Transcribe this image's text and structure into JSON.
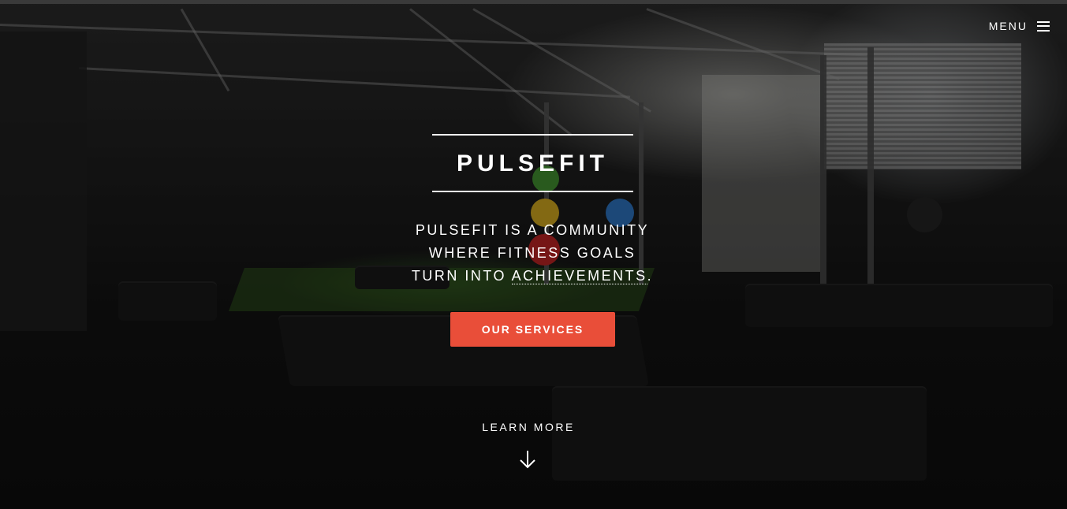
{
  "header": {
    "menu_label": "MENU",
    "menu_icon": "hamburger-icon"
  },
  "hero": {
    "title": "PULSEFIT",
    "tagline_line1": "PULSEFIT IS A COMMUNITY",
    "tagline_line2": "WHERE FITNESS GOALS",
    "tagline_line3_prefix": "TURN INTO ",
    "tagline_link": "ACHIEVEMENTS",
    "tagline_line3_suffix": ".",
    "cta_label": "OUR SERVICES",
    "learn_more_label": "LEARN MORE",
    "learn_more_icon": "arrow-down-icon",
    "background_image": "gym-interior-photo"
  },
  "colors": {
    "accent": "#e94e39",
    "text": "#ffffff"
  }
}
